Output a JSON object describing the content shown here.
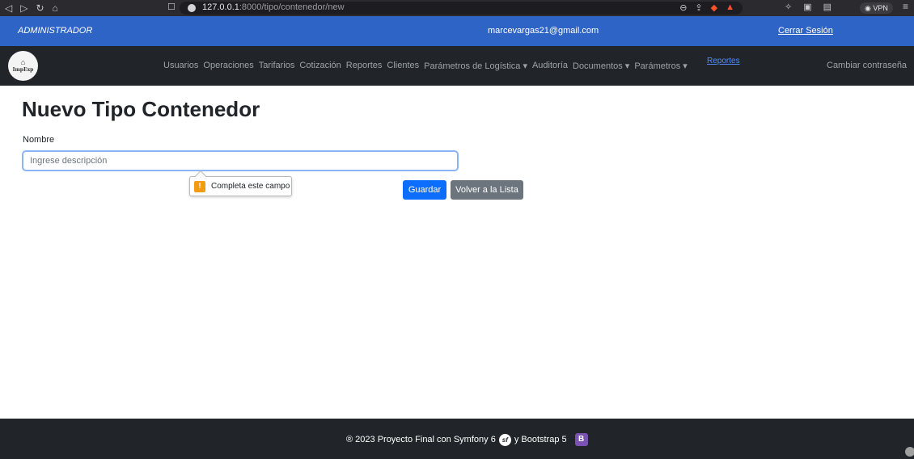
{
  "browser": {
    "url_host": "127.0.0.1",
    "url_path": ":8000/tipo/contenedor/new",
    "vpn_label": "VPN"
  },
  "admin_bar": {
    "role": "ADMINISTRADOR",
    "email": "marcevargas21@gmail.com",
    "logout": "Cerrar Sesión",
    "color": "#2e64c6"
  },
  "navbar": {
    "logo_text": "ImpExp",
    "items": [
      {
        "label": "Usuarios"
      },
      {
        "label": "Operaciones"
      },
      {
        "label": "Tarifarios"
      },
      {
        "label": "Cotización"
      },
      {
        "label": "Reportes"
      },
      {
        "label": "Clientes"
      },
      {
        "label": "Parámetros de Logística ▾"
      },
      {
        "label": "Auditoría"
      },
      {
        "label": "Documentos ▾"
      },
      {
        "label": "Parámetros ▾"
      }
    ],
    "highlight_link": "Reportes",
    "change_password": "Cambiar contraseña"
  },
  "form": {
    "title": "Nuevo Tipo Contenedor",
    "name_label": "Nombre",
    "name_placeholder": "Ingrese descripción",
    "name_value": "",
    "validation_message": "Completa este campo",
    "save_label": "Guardar",
    "back_label": "Volver a la Lista"
  },
  "footer": {
    "text_before": "® 2023 Proyecto Final con Symfony 6",
    "text_middle": "y Bootstrap 5",
    "sf_glyph": "sf",
    "bs_glyph": "B"
  }
}
